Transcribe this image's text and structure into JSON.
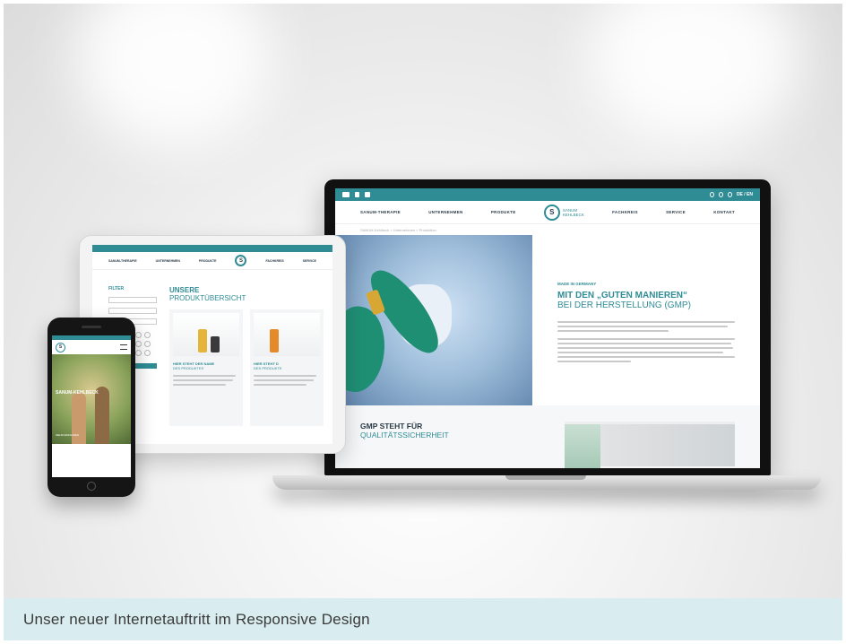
{
  "caption": "Unser neuer Internetauftritt im Responsive Design",
  "colors": {
    "accent": "#2f8c95",
    "caption_bg": "#d9ecef",
    "dark_text": "#2b3b47"
  },
  "laptop": {
    "lang": "DE / EN",
    "nav": [
      "SANUM-THERAPIE",
      "UNTERNEHMEN",
      "PRODUKTE",
      "FACHKREIS",
      "SERVICE",
      "KONTAKT"
    ],
    "logo_text": [
      "SANUM",
      "KEHLBECK"
    ],
    "breadcrumb": "SANUM-Kehlbeck  >  Unternehmen  >  Produktion",
    "kicker": "MADE IN GERMANY",
    "headline": "MIT DEN „GUTEN MANIEREN“",
    "subheadline": "BEI DER HERSTELLUNG (GMP)",
    "section_title": "GMP STEHT FÜR",
    "section_subtitle": "QUALITÄTSSICHERHEIT"
  },
  "tablet": {
    "nav": [
      "SANUM-THERAPIE",
      "UNTERNEHMEN",
      "PRODUKTE",
      "FACHKREIS",
      "SERVICE"
    ],
    "filter_title": "FILTER",
    "title": "UNSERE",
    "subtitle": "PRODUKTÜBERSICHT",
    "cards": [
      {
        "title": "HIER STEHT DER NAME",
        "subtitle": "DES PRODUKTES"
      },
      {
        "title": "HIER STEHT D",
        "subtitle": "DES PRODUKTE"
      }
    ]
  },
  "phone": {
    "hero_text": "SANUM-KEHLBECK",
    "more": "MEHR ERFAHREN"
  }
}
